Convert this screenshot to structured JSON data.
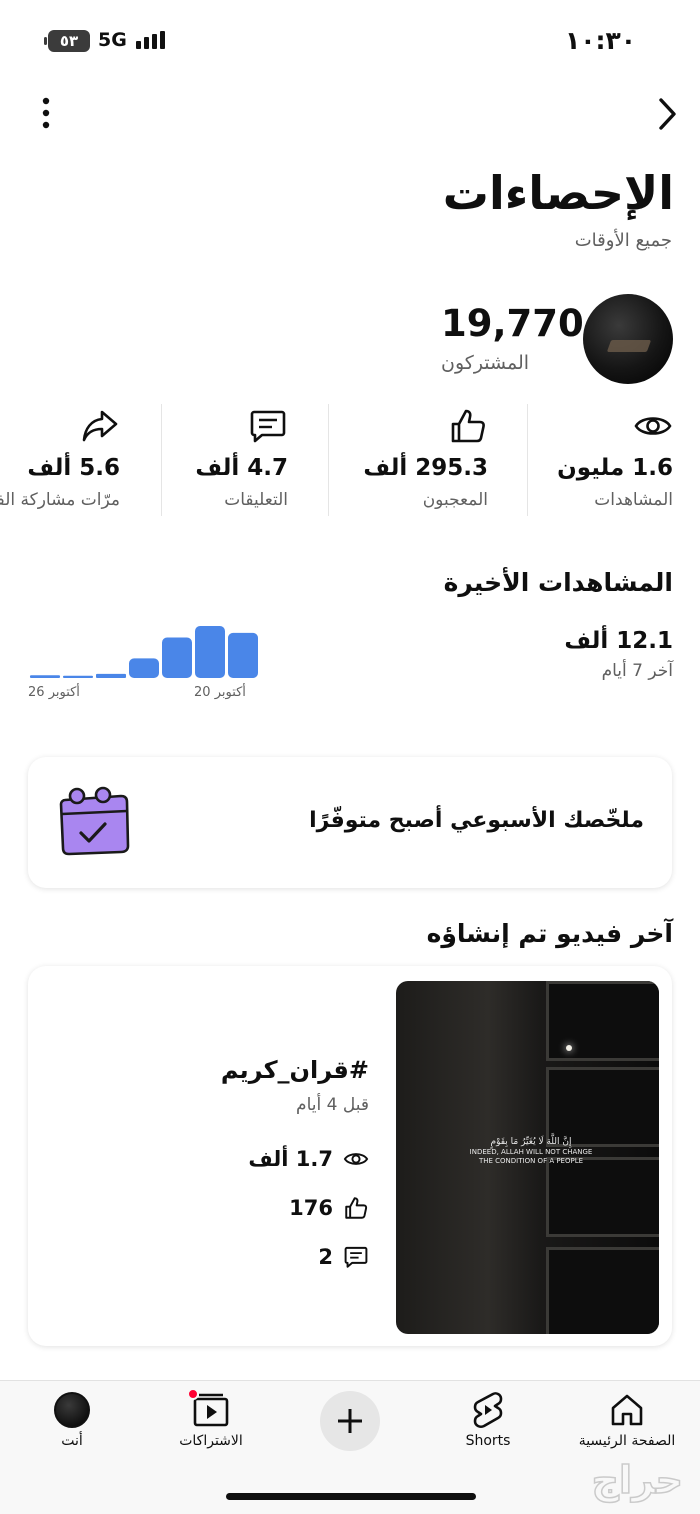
{
  "status_bar": {
    "time": "١٠:٣٠",
    "battery": "٥٣",
    "network": "5G"
  },
  "header": {
    "title": "الإحصاءات",
    "subtitle": "جميع الأوقات"
  },
  "channel": {
    "subscribers": "19,770",
    "subscribers_label": "المشتركون"
  },
  "metrics": [
    {
      "value": "1.6 مليون",
      "label": "المشاهدات",
      "icon": "eye-icon"
    },
    {
      "value": "295.3 ألف",
      "label": "المعجبون",
      "icon": "thumbs-up-icon"
    },
    {
      "value": "4.7 ألف",
      "label": "التعليقات",
      "icon": "comment-icon"
    },
    {
      "value": "5.6 ألف",
      "label": "مرّات مشاركة الفيد",
      "icon": "share-icon"
    }
  ],
  "recent_views": {
    "title": "المشاهدات الأخيرة",
    "value": "12.1 ألف",
    "caption": "آخر 7 أيام"
  },
  "chart_data": {
    "type": "bar",
    "categories": [
      "20 أكتوبر",
      "21",
      "22",
      "23",
      "24",
      "25",
      "26 أكتوبر"
    ],
    "values": [
      1.95,
      2.25,
      1.75,
      0.85,
      0.18,
      0.1,
      0.12
    ],
    "x_tick_labels": [
      "26 أكتوبر",
      "20 أكتوبر"
    ],
    "color": "#4a86e8",
    "title": "",
    "xlabel": "",
    "ylabel": ""
  },
  "weekly_summary": {
    "text": "ملخّصك الأسبوعي أصبح متوفّرًا"
  },
  "latest_video": {
    "section_title": "آخر فيديو تم إنشاؤه",
    "title": "#قران_كريم",
    "date": "قبل 4 أيام",
    "views": "1.7 ألف",
    "likes": "176",
    "comments": "2",
    "thumb_caption": "إِنَّ اللَّهَ لَا يُغَيِّرُ مَا بِقَوْمٍ",
    "thumb_caption_en": "INDEED, ALLAH WILL NOT CHANGE THE CONDITION OF A PEOPLE"
  },
  "bottom_nav": {
    "home": "الصفحة الرئيسية",
    "shorts": "Shorts",
    "subscriptions": "الاشتراكات",
    "you": "أنت"
  },
  "watermark": "حراج"
}
